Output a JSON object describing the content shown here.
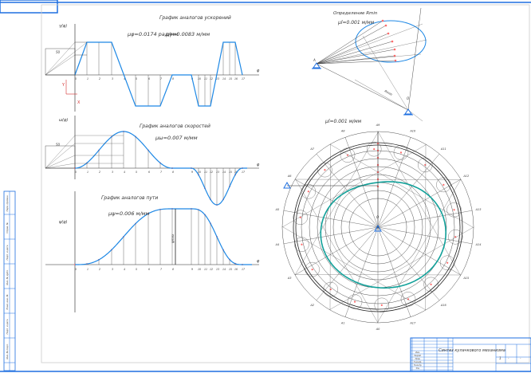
{
  "colors": {
    "curve": "#1e88e5",
    "cam_profile": "#12a19a",
    "frame": "#1e6fe0",
    "point": "#ff6b6b",
    "axis_marker": "#d32f2f",
    "line": "#222"
  },
  "acceleration_chart": {
    "title": "График аналогов ускорений",
    "scale_phi": "μφ=0.0174 рад/мм",
    "scale_y": "μγ=0.0083 м/мм",
    "ylabel": "γ(φ)",
    "xlabel": "φ",
    "pole_distance": "50",
    "ticks": [
      "0",
      "1",
      "2",
      "3",
      "4",
      "5",
      "6",
      "7",
      "8",
      "9",
      "10",
      "11",
      "12",
      "13",
      "14",
      "15",
      "16",
      "17"
    ],
    "axis_x": "X",
    "axis_y": "Y"
  },
  "velocity_chart": {
    "title": "График аналогов скоростей",
    "scale": "μω=0.007 м/мм",
    "ylabel": "ω(φ)",
    "xlabel": "φ",
    "pole_distance": "50",
    "ticks": [
      "0",
      "1",
      "2",
      "3",
      "4",
      "5",
      "6",
      "7",
      "8",
      "9",
      "10",
      "11",
      "12",
      "13",
      "14",
      "15",
      "16",
      "17"
    ]
  },
  "displacement_chart": {
    "title": "График аналогов пути",
    "scale": "μψ=0.006 м/мм",
    "ylabel": "ψ(φ)",
    "xlabel": "φ",
    "max_label": "ψmax",
    "ticks": [
      "0",
      "1",
      "2",
      "3",
      "4",
      "5",
      "6",
      "7",
      "8",
      "9",
      "10",
      "11",
      "12",
      "13",
      "14",
      "15",
      "16",
      "17"
    ]
  },
  "rmin_diagram": {
    "title": "Определение Rmin",
    "scale": "μl=0.001 м/мм",
    "pivot_label": "A",
    "center_label": "O",
    "angle_label": "Rmin"
  },
  "cam_diagram": {
    "scale": "μl=0.001 м/мм",
    "center_label": "O",
    "rays": [
      "A0",
      "A1",
      "A2",
      "A3",
      "A4",
      "A5",
      "A6",
      "A7",
      "A8",
      "A9",
      "A10",
      "A11",
      "A12",
      "A13",
      "A14",
      "A15",
      "A16",
      "A17"
    ]
  },
  "title_block": {
    "title": "Синтез кулачкового механизма",
    "sheet": "1",
    "mass": "-",
    "scale": "-",
    "rows": [
      "Изм.",
      "Разраб.",
      "Пров.",
      "Т.контр.",
      "Н.контр.",
      "Утв."
    ]
  },
  "side_stamp": [
    "Перв. примен.",
    "Справ. №",
    "Подп. и дата",
    "Инв. № дубл.",
    "Взам. инв. №",
    "Подп. и дата",
    "Инв. № подл."
  ]
}
